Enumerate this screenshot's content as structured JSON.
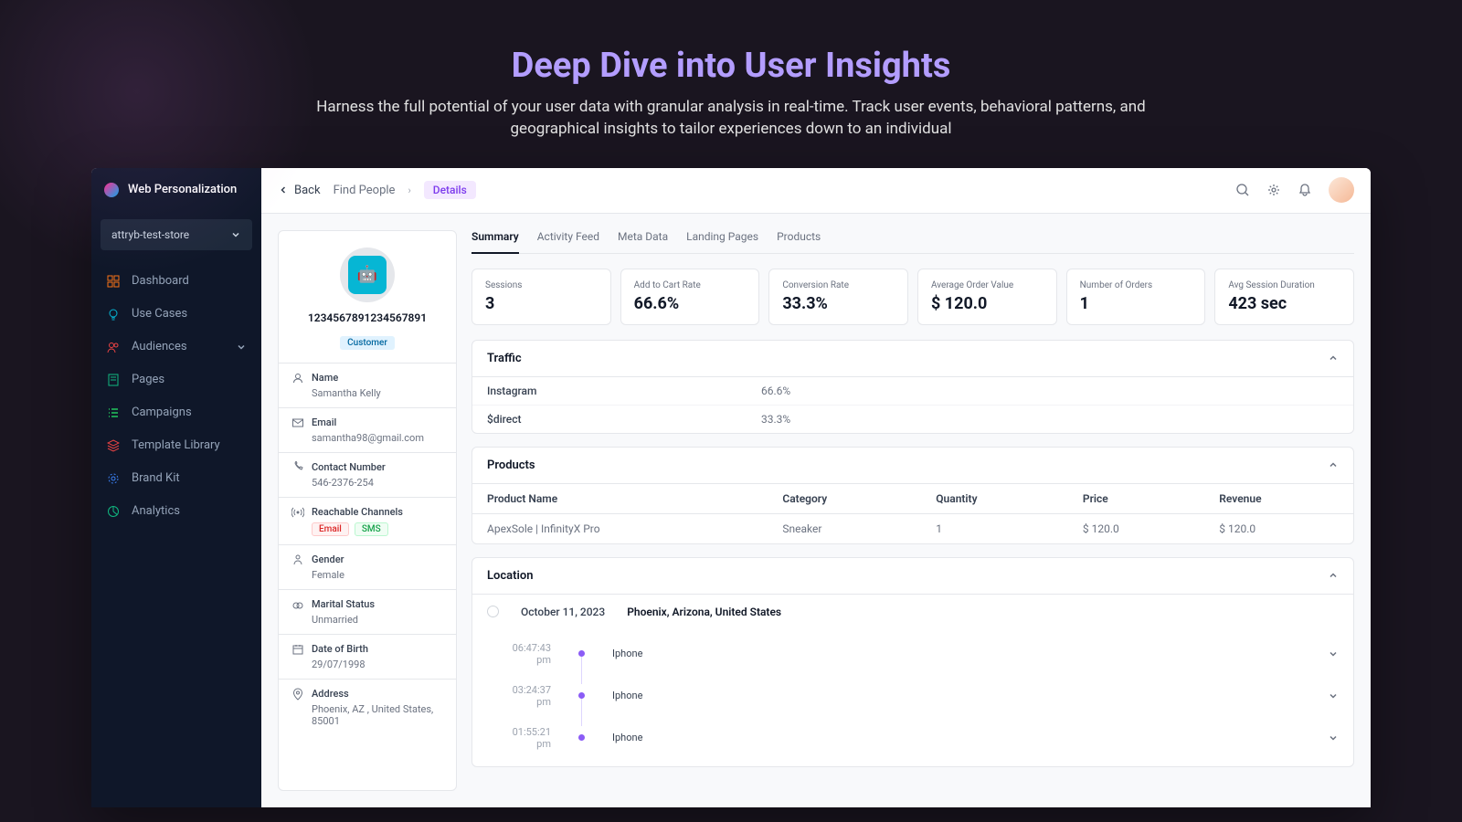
{
  "hero": {
    "title": "Deep Dive into User Insights",
    "subtitle": "Harness the full potential of your user data with granular analysis in real-time. Track user events, behavioral patterns, and geographical insights to tailor experiences down to an individual"
  },
  "sidebar": {
    "app_name": "Web Personalization",
    "store": "attryb-test-store",
    "nav": {
      "dashboard": "Dashboard",
      "use_cases": "Use Cases",
      "audiences": "Audiences",
      "pages": "Pages",
      "campaigns": "Campaigns",
      "template_library": "Template Library",
      "brand_kit": "Brand Kit",
      "analytics": "Analytics"
    }
  },
  "topbar": {
    "back": "Back",
    "crumb1": "Find People",
    "crumb2": "Details"
  },
  "profile": {
    "id": "1234567891234567891",
    "badge": "Customer",
    "fields": {
      "name_label": "Name",
      "name_value": "Samantha Kelly",
      "email_label": "Email",
      "email_value": "samantha98@gmail.com",
      "contact_label": "Contact Number",
      "contact_value": "546-2376-254",
      "channels_label": "Reachable Channels",
      "channel_email": "Email",
      "channel_sms": "SMS",
      "gender_label": "Gender",
      "gender_value": "Female",
      "marital_label": "Marital Status",
      "marital_value": "Unmarried",
      "dob_label": "Date of Birth",
      "dob_value": "29/07/1998",
      "address_label": "Address",
      "address_value": "Phoenix, AZ , United States, 85001"
    }
  },
  "tabs": {
    "summary": "Summary",
    "activity": "Activity Feed",
    "meta": "Meta Data",
    "landing": "Landing Pages",
    "products": "Products"
  },
  "stats": {
    "sessions_label": "Sessions",
    "sessions_value": "3",
    "cart_label": "Add to Cart Rate",
    "cart_value": "66.6%",
    "conv_label": "Conversion Rate",
    "conv_value": "33.3%",
    "aov_label": "Average Order Value",
    "aov_value": "$ 120.0",
    "orders_label": "Number of Orders",
    "orders_value": "1",
    "duration_label": "Avg Session Duration",
    "duration_value": "423 sec"
  },
  "traffic": {
    "title": "Traffic",
    "rows": {
      "r0_name": "Instagram",
      "r0_val": "66.6%",
      "r1_name": "$direct",
      "r1_val": "33.3%"
    }
  },
  "products": {
    "title": "Products",
    "cols": {
      "c0": "Product Name",
      "c1": "Category",
      "c2": "Quantity",
      "c3": "Price",
      "c4": "Revenue"
    },
    "row": {
      "name": "ApexSole | InfinityX Pro",
      "category": "Sneaker",
      "quantity": "1",
      "price": "$ 120.0",
      "revenue": "$ 120.0"
    }
  },
  "location": {
    "title": "Location",
    "date": "October 11, 2023",
    "place": "Phoenix, Arizona, United States",
    "timeline": {
      "t0_time": "06:47:43 pm",
      "t0_label": "Iphone",
      "t1_time": "03:24:37 pm",
      "t1_label": "Iphone",
      "t2_time": "01:55:21 pm",
      "t2_label": "Iphone"
    }
  }
}
